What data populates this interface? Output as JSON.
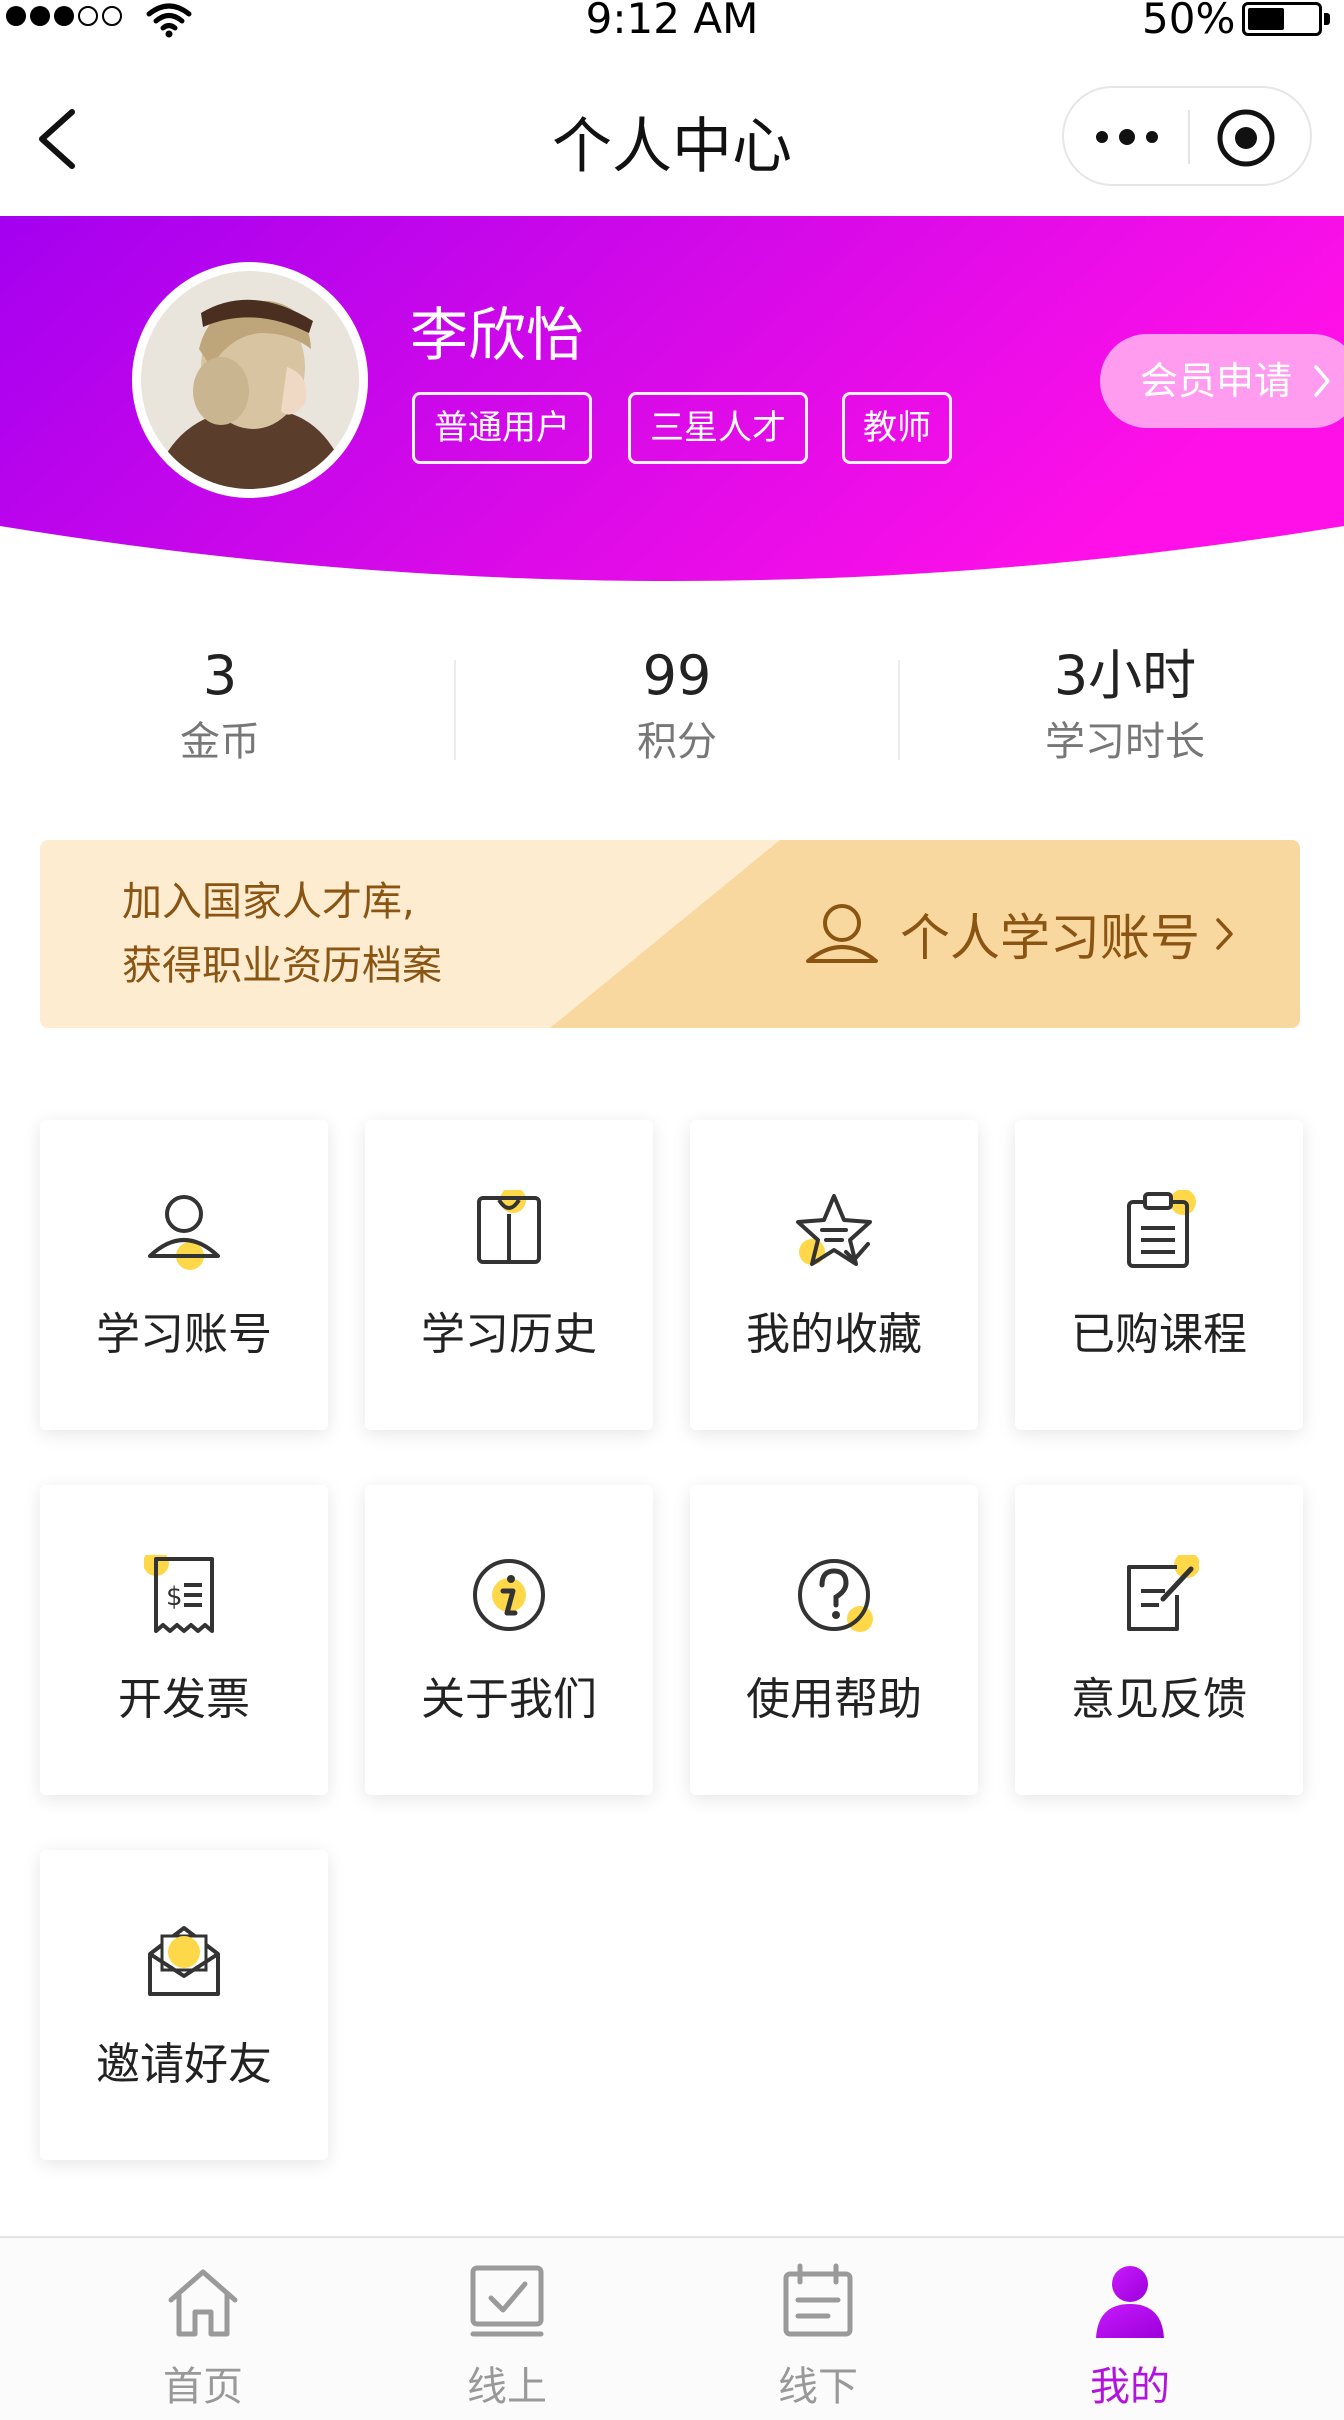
{
  "status_bar": {
    "time": "9:12 AM",
    "battery": "50%"
  },
  "nav": {
    "title": "个人中心"
  },
  "profile": {
    "name": "李欣怡",
    "tags": [
      "普通用户",
      "三星人才",
      "教师"
    ],
    "member_button": "会员申请",
    "colors": {
      "gradient_start": "#a400f0",
      "gradient_end": "#ff10e8"
    }
  },
  "stats": [
    {
      "value": "3",
      "label": "金币"
    },
    {
      "value": "99",
      "label": "积分"
    },
    {
      "value": "3小时",
      "label": "学习时长"
    }
  ],
  "banner": {
    "line1": "加入国家人才库,",
    "line2": "获得职业资历档案",
    "link_label": "个人学习账号",
    "text_color": "#8a5513"
  },
  "grid": [
    {
      "label": "学习账号",
      "icon": "user-icon"
    },
    {
      "label": "学习历史",
      "icon": "book-icon"
    },
    {
      "label": "我的收藏",
      "icon": "star-icon"
    },
    {
      "label": "已购课程",
      "icon": "clipboard-icon"
    },
    {
      "label": "开发票",
      "icon": "receipt-icon"
    },
    {
      "label": "关于我们",
      "icon": "info-icon"
    },
    {
      "label": "使用帮助",
      "icon": "help-icon"
    },
    {
      "label": "意见反馈",
      "icon": "feedback-icon"
    },
    {
      "label": "邀请好友",
      "icon": "envelope-icon"
    }
  ],
  "tabs": [
    {
      "label": "首页",
      "icon": "home-icon"
    },
    {
      "label": "线上",
      "icon": "online-icon"
    },
    {
      "label": "线下",
      "icon": "calendar-icon"
    },
    {
      "label": "我的",
      "icon": "profile-icon",
      "active": true
    }
  ],
  "accent_color": "#b214e0",
  "highlight_dot_color": "#ffd84a"
}
